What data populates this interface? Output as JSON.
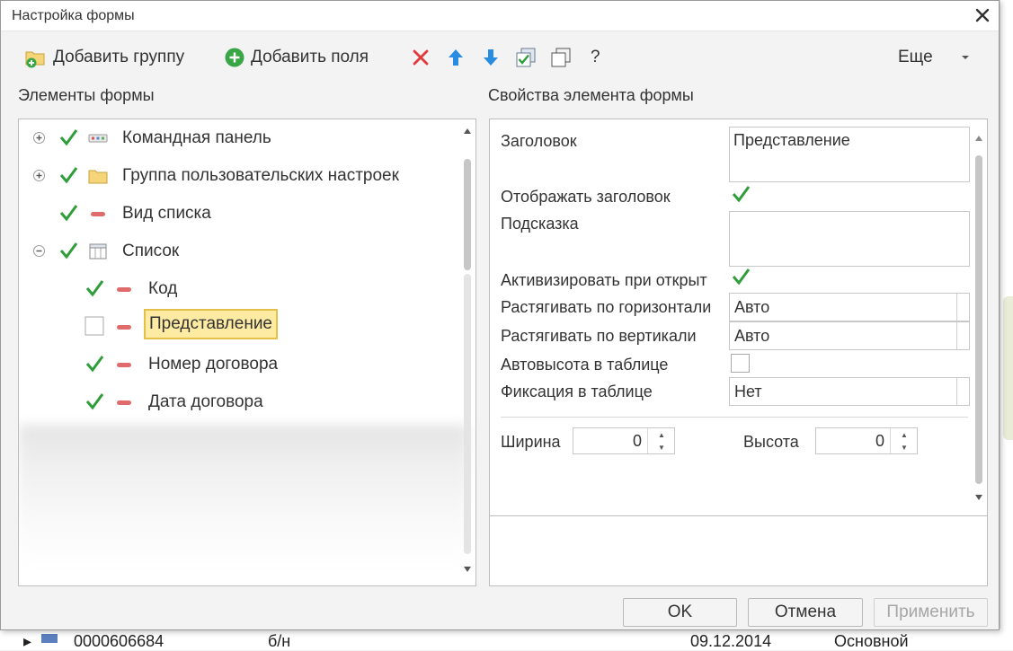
{
  "window": {
    "title": "Настройка формы"
  },
  "toolbar": {
    "add_group_label": "Добавить группу",
    "add_fields_label": "Добавить поля",
    "help_label": "?",
    "more_label": "Еще",
    "icons": [
      "folder-add-icon",
      "plus-circle-icon",
      "delete-icon",
      "move-up-icon",
      "move-down-icon",
      "check-all-icon",
      "uncheck-all-icon"
    ]
  },
  "left_panel": {
    "title": "Элементы формы",
    "items": [
      {
        "label": "Командная панель",
        "checked": true,
        "expander": "plus",
        "icon": "command-bar-icon",
        "level": 0
      },
      {
        "label": "Группа пользовательских настроек",
        "checked": true,
        "expander": "plus",
        "icon": "folder-icon",
        "level": 0
      },
      {
        "label": "Вид списка",
        "checked": true,
        "expander": "none",
        "icon": "field-icon",
        "level": 0
      },
      {
        "label": "Список",
        "checked": true,
        "expander": "minus",
        "icon": "table-icon",
        "level": 0
      },
      {
        "label": "Код",
        "checked": true,
        "expander": "none",
        "icon": "field-icon",
        "level": 1
      },
      {
        "label": "Представление",
        "checked": false,
        "expander": "none",
        "icon": "field-icon",
        "level": 1,
        "selected": true
      },
      {
        "label": "Номер договора",
        "checked": true,
        "expander": "none",
        "icon": "field-icon",
        "level": 1
      },
      {
        "label": "Дата договора",
        "checked": true,
        "expander": "none",
        "icon": "field-icon",
        "level": 1
      }
    ]
  },
  "right_panel": {
    "title": "Свойства элемента формы",
    "caption_label": "Заголовок",
    "caption_value": "Представление",
    "show_caption_label": "Отображать заголовок",
    "show_caption_checked": true,
    "hint_label": "Подсказка",
    "hint_value": "",
    "activate_label": "Активизировать при открыт",
    "activate_checked": true,
    "stretch_h_label": "Растягивать по горизонтали",
    "stretch_h_value": "Авто",
    "stretch_v_label": "Растягивать по вертикали",
    "stretch_v_value": "Авто",
    "autoheight_label": "Автовысота в таблице",
    "autoheight_checked": false,
    "fix_label": "Фиксация в таблице",
    "fix_value": "Нет",
    "width_label": "Ширина",
    "width_value": "0",
    "height_label": "Высота",
    "height_value": "0"
  },
  "footer": {
    "ok_label": "OK",
    "cancel_label": "Отмена",
    "apply_label": "Применить"
  },
  "background_row": {
    "number": "0000606684",
    "type": "б/н",
    "date": "09.12.2014",
    "kind": "Основной"
  },
  "colors": {
    "check": "#2e9d3a",
    "delete": "#e03a3a",
    "arrow": "#2a8ce0",
    "selection_fill": "#fdeaa3",
    "selection_border": "#e3c04a",
    "field_icon": "#e06b6b"
  }
}
